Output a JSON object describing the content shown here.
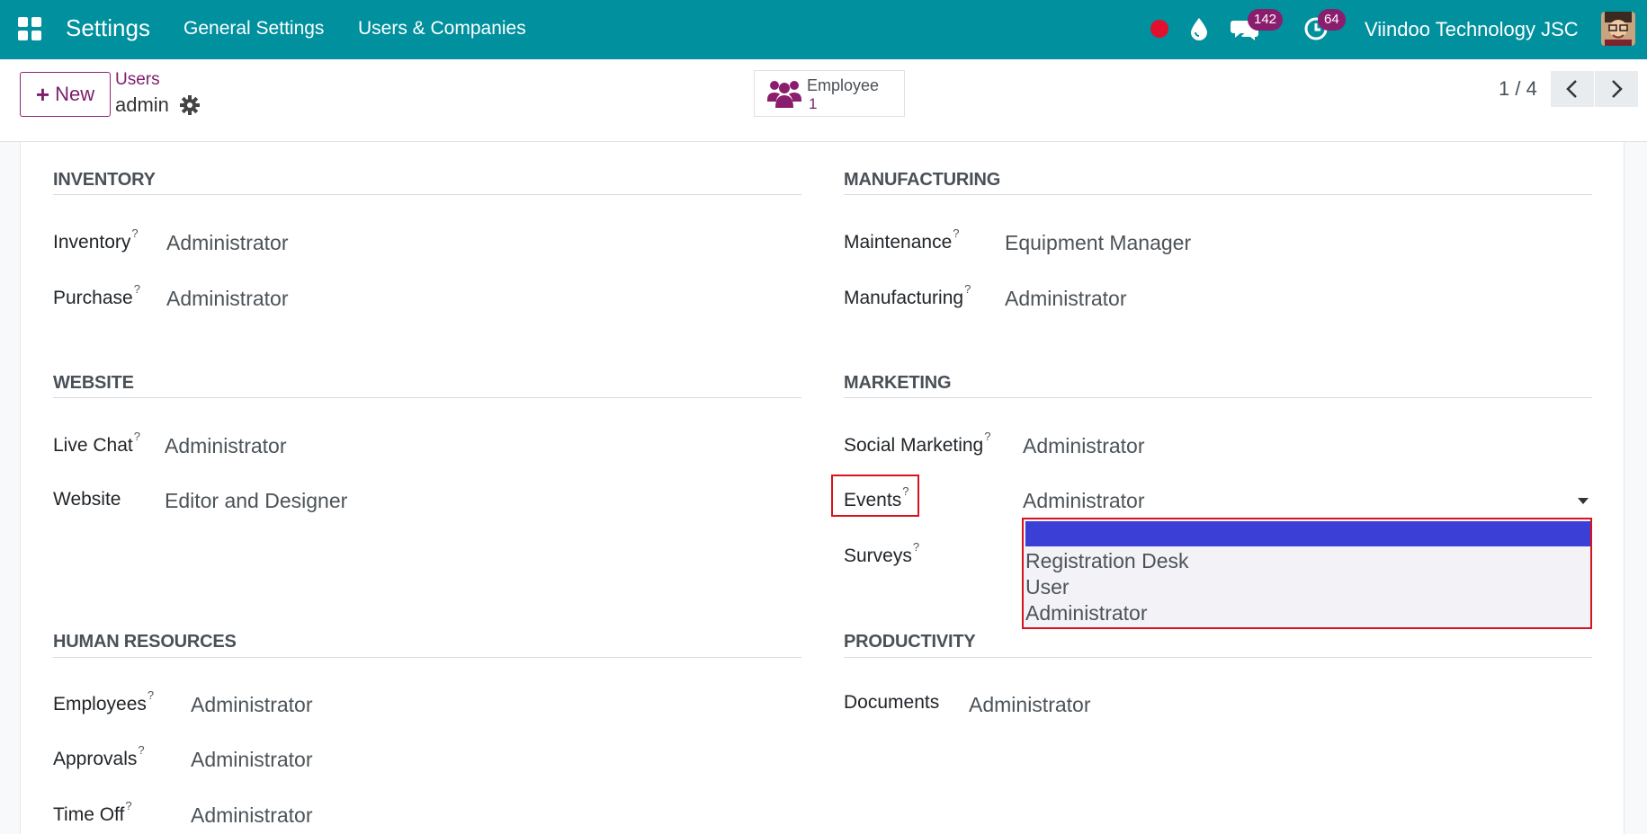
{
  "navbar": {
    "brand": "Settings",
    "menus": [
      "General Settings",
      "Users & Companies"
    ],
    "chat_count": "142",
    "activity_count": "64",
    "company": "Viindoo Technology JSC",
    "accent_color": "#00909e",
    "badge_color": "#8b1d6e"
  },
  "control": {
    "new_label": "New",
    "breadcrumb_parent": "Users",
    "breadcrumb_current": "admin",
    "smart_button": {
      "label": "Employee",
      "value": "1"
    },
    "pager": "1 / 4"
  },
  "sections": {
    "inventory": {
      "title": "INVENTORY",
      "fields": [
        {
          "label": "Inventory",
          "help": "?",
          "value": "Administrator"
        },
        {
          "label": "Purchase",
          "help": "?",
          "value": "Administrator"
        }
      ]
    },
    "manufacturing": {
      "title": "MANUFACTURING",
      "fields": [
        {
          "label": "Maintenance",
          "help": "?",
          "value": "Equipment Manager"
        },
        {
          "label": "Manufacturing",
          "help": "?",
          "value": "Administrator"
        }
      ]
    },
    "website": {
      "title": "WEBSITE",
      "fields": [
        {
          "label": "Live Chat",
          "help": "?",
          "value": "Administrator"
        },
        {
          "label": "Website",
          "help": "",
          "value": "Editor and Designer"
        }
      ]
    },
    "marketing": {
      "title": "MARKETING",
      "fields": [
        {
          "label": "Social Marketing",
          "help": "?",
          "value": "Administrator"
        },
        {
          "label": "Events",
          "help": "?",
          "value": "Administrator"
        },
        {
          "label": "Surveys",
          "help": "?",
          "value": ""
        }
      ]
    },
    "human_resources": {
      "title": "HUMAN RESOURCES",
      "fields": [
        {
          "label": "Employees",
          "help": "?",
          "value": "Administrator"
        },
        {
          "label": "Approvals",
          "help": "?",
          "value": "Administrator"
        },
        {
          "label": "Time Off",
          "help": "?",
          "value": "Administrator"
        }
      ]
    },
    "productivity": {
      "title": "PRODUCTIVITY",
      "fields": [
        {
          "label": "Documents",
          "help": "",
          "value": "Administrator"
        }
      ]
    }
  },
  "events_dropdown": {
    "options": [
      "",
      "Registration Desk",
      "User",
      "Administrator"
    ],
    "highlight_color": "#d7141e",
    "selected_color": "#3b3fd6"
  }
}
